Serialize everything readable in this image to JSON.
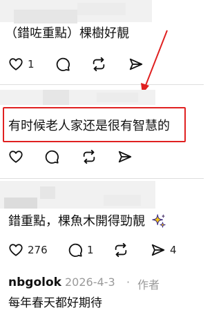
{
  "comments": [
    {
      "text": "（錯咗重點）棵樹好靚",
      "likes": "1",
      "reposts": "",
      "shares": ""
    },
    {
      "text": "有时候老人家还是很有智慧的",
      "likes": "",
      "reposts": "",
      "shares": ""
    },
    {
      "text": "錯重點，棵魚木開得勁靚",
      "emoji": "sparkles-icon",
      "likes": "276",
      "reposts": "1",
      "shares": "4"
    },
    {
      "username": "nbgolok",
      "date": "2026-4-3",
      "separator": "·",
      "role": "作者",
      "text": "每年春天都好⁣⁣期待"
    }
  ],
  "annotation": {
    "box_color": "#e02020",
    "arrow_color": "#e02020"
  },
  "colors": {
    "icon": "#111111",
    "meta": "#9a9a9a",
    "divider": "#dedede"
  }
}
